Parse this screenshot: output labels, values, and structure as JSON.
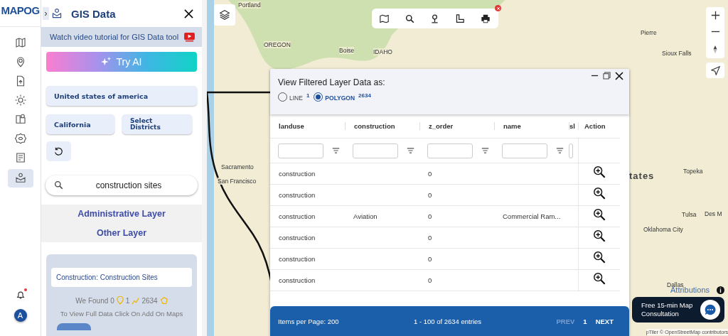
{
  "brand": {
    "logo": "MAPOG"
  },
  "rail": {
    "items": [
      {
        "kind": "map",
        "selected": false
      },
      {
        "kind": "pin",
        "selected": false
      },
      {
        "kind": "upload",
        "selected": false
      },
      {
        "kind": "gear",
        "selected": false
      },
      {
        "kind": "mappin",
        "selected": false
      },
      {
        "kind": "eyegear",
        "selected": false
      },
      {
        "kind": "list",
        "selected": false
      },
      {
        "kind": "layer",
        "selected": true
      }
    ],
    "notification_unread": true,
    "avatar": "A"
  },
  "panel": {
    "expand_glyph": "›",
    "title": "GIS Data",
    "tutorial": "Watch video tutorial for GIS Data tool",
    "try_ai": "Try AI",
    "country": "United states of america",
    "state": "California",
    "districts": "Select Districts",
    "search": {
      "value": "construction sites"
    },
    "sections": [
      "Administrative Layer",
      "Other Layer"
    ],
    "result": {
      "title": "Construction: Construction Sites",
      "found_label": "We Found",
      "points": "0",
      "lines": "1",
      "polygons": "2634",
      "hint": "To View Full Data Click On Add On Maps"
    }
  },
  "map": {
    "labels": [
      "Portland",
      "OREGON",
      "Boise",
      "IDAHO",
      "Pierre",
      "Sioux Falls",
      "Sacramento",
      "San Francisco",
      "Topeka",
      "tates",
      "Tulsa",
      "Oklahoma City",
      "Dallas",
      "Des M"
    ],
    "attribution_link": "Attributions",
    "info_glyph": "i",
    "credits": "pTiler © OpenStreetMap contributors"
  },
  "layer_window": {
    "title": "View Filtered Layer Data as:",
    "options": [
      {
        "label": "LINE",
        "count": "1",
        "selected": false
      },
      {
        "label": "POLYGON",
        "count": "2634",
        "selected": true
      }
    ],
    "table": {
      "columns": [
        "landuse",
        "construction",
        "z_order",
        "name",
        "sl",
        "Action"
      ],
      "rows": [
        [
          "construction",
          "",
          "0",
          ""
        ],
        [
          "construction",
          "",
          "0",
          ""
        ],
        [
          "construction",
          "Aviation",
          "0",
          "Commercial Ram..."
        ],
        [
          "construction",
          "",
          "0",
          ""
        ],
        [
          "construction",
          "",
          "0",
          ""
        ],
        [
          "construction",
          "",
          "0",
          ""
        ]
      ]
    },
    "footer": {
      "per_page": "Items per Page: 200",
      "range": "1 - 100 of 2634 entries",
      "prev": "PREV",
      "page": "1",
      "next": "NEXT"
    }
  },
  "consultation": "Free 15-min Map Consultation"
}
